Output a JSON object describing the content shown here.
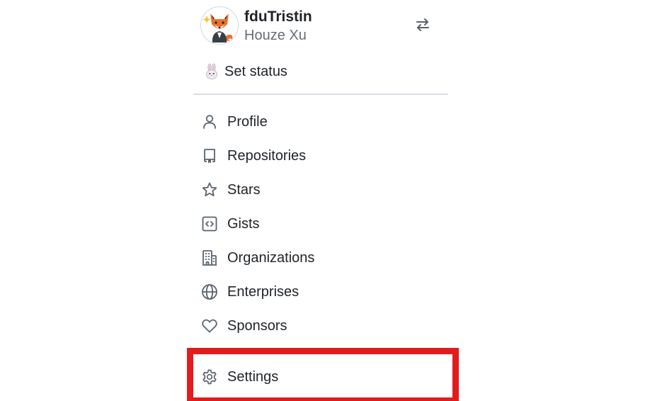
{
  "user": {
    "username": "fduTristin",
    "full_name": "Houze Xu",
    "avatar_icon": "fox-avatar-icon",
    "switch_account_icon": "arrow-switch-icon"
  },
  "status": {
    "emoji_icon": "rabbit-emoji-icon",
    "label": "Set status"
  },
  "menu": {
    "items": [
      {
        "label": "Profile",
        "icon": "person-icon"
      },
      {
        "label": "Repositories",
        "icon": "repo-icon"
      },
      {
        "label": "Stars",
        "icon": "star-icon"
      },
      {
        "label": "Gists",
        "icon": "code-square-icon"
      },
      {
        "label": "Organizations",
        "icon": "organization-icon"
      },
      {
        "label": "Enterprises",
        "icon": "globe-icon"
      },
      {
        "label": "Sponsors",
        "icon": "heart-icon"
      },
      {
        "label": "Settings",
        "icon": "gear-icon"
      }
    ]
  },
  "colors": {
    "text": "#1f2328",
    "muted": "#656d76",
    "icon": "#59636e",
    "divider": "#d8dee4",
    "highlight": "#e21c1c"
  }
}
